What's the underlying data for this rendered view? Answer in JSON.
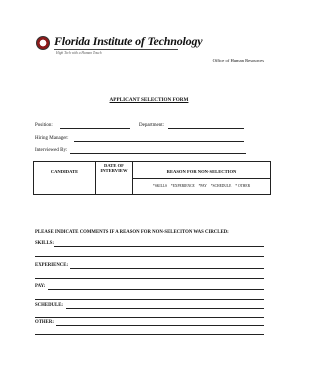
{
  "header": {
    "logo_name": "Florida Institute of Technology",
    "logo_tagline": "High Tech with a Human Touch",
    "office": "Office of Human Resources"
  },
  "form": {
    "title": "APPLICANT SELECTION FORM",
    "fields": {
      "position": "Position:",
      "department": "Department:",
      "hiring_manager": "Hiring Manager:",
      "interviewed_by": "Interviewed By:"
    }
  },
  "table": {
    "headers": {
      "candidate": "CANDIDATE",
      "date_of_interview_line1": "DATE OF",
      "date_of_interview_line2": "INTERVIEW",
      "reason": "REASON FOR NON-SELECTION"
    },
    "reasons": [
      "*SKILLS",
      "*EXPERIENCE",
      "*PAY",
      "*SCHEDULE",
      "* OTHER"
    ]
  },
  "comments": {
    "instruction": "PLEASE INDICATE COMMENTS IF A REASON FOR NON-SELECITON WAS CIRCLED:",
    "categories": {
      "skills": "SKILLS:",
      "experience": "EXPERIENCE:",
      "pay": "PAY:",
      "schedule": "SCHEDULE:",
      "other": "OTHER:"
    }
  }
}
